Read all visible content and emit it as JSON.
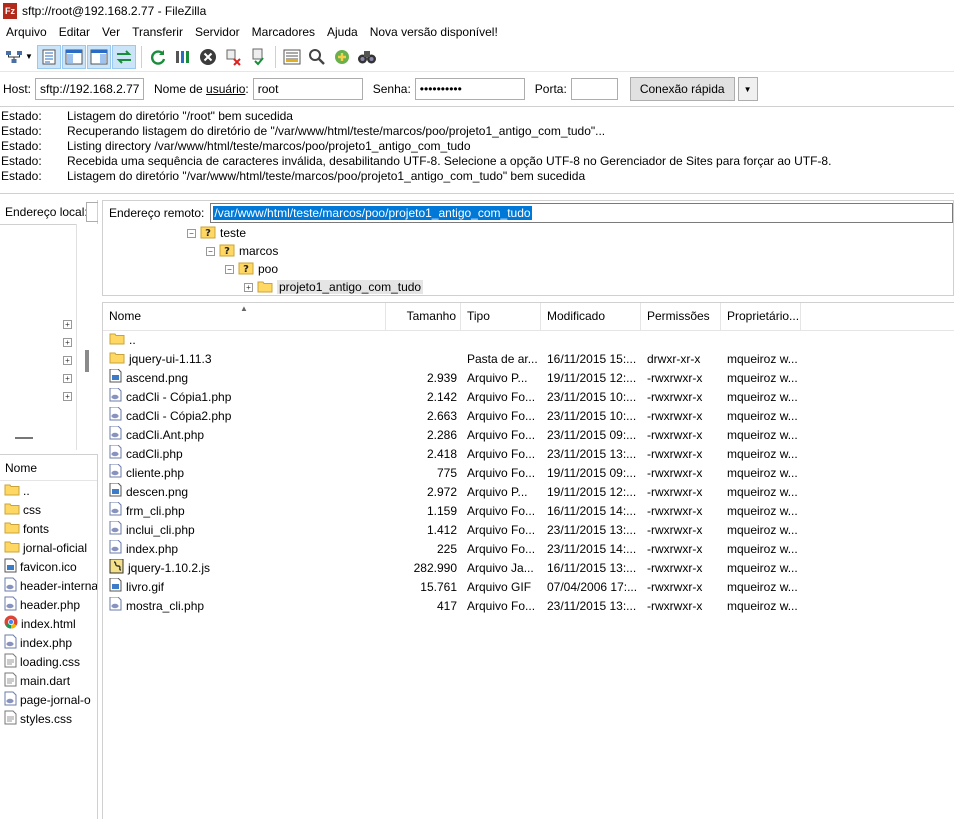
{
  "window": {
    "app_icon_text": "Fz",
    "title": "sftp://root@192.168.2.77 - FileZilla"
  },
  "menu": {
    "items": [
      "Arquivo",
      "Editar",
      "Ver",
      "Transferir",
      "Servidor",
      "Marcadores",
      "Ajuda",
      "Nova versão disponível!"
    ]
  },
  "toolbar": {
    "icons": [
      "site-manager-icon",
      "dropdown-caret-icon",
      "toggle-log-icon",
      "toggle-local-tree-icon",
      "toggle-remote-tree-icon",
      "toggle-queue-icon",
      "refresh-icon",
      "process-queue-icon",
      "cancel-icon",
      "disconnect-icon",
      "reconnect-icon",
      "filter-icon",
      "toggle-compare-icon",
      "sync-browse-icon",
      "search-binoculars-icon"
    ]
  },
  "quickconnect": {
    "host_label": "Host:",
    "host_value": "sftp://192.168.2.77",
    "user_label_pre": "Nome de ",
    "user_label_u": "usuário",
    "user_label_post": ":",
    "user_value": "root",
    "pass_label": "Senha:",
    "pass_value": "••••••••••",
    "port_label": "Porta:",
    "port_value": "",
    "connect_button": "Conexão rápida"
  },
  "log": {
    "entries": [
      {
        "label": "Estado:",
        "msg": "Listagem do diretório \"/root\" bem sucedida"
      },
      {
        "label": "Estado:",
        "msg": "Recuperando listagem do diretório de \"/var/www/html/teste/marcos/poo/projeto1_antigo_com_tudo\"..."
      },
      {
        "label": "Estado:",
        "msg": "Listing directory /var/www/html/teste/marcos/poo/projeto1_antigo_com_tudo"
      },
      {
        "label": "Estado:",
        "msg": "Recebida uma sequência de caracteres inválida, desabilitando UTF-8. Selecione a opção UTF-8 no Gerenciador de Sites para forçar ao UTF-8."
      },
      {
        "label": "Estado:",
        "msg": "Listagem do diretório \"/var/www/html/teste/marcos/poo/projeto1_antigo_com_tudo\" bem sucedida"
      }
    ]
  },
  "local": {
    "address_label": "Endereço local:",
    "list_header": "Nome",
    "files": [
      {
        "name": "..",
        "icon": "folder-icon"
      },
      {
        "name": "css",
        "icon": "folder-icon"
      },
      {
        "name": "fonts",
        "icon": "folder-icon"
      },
      {
        "name": "jornal-oficial",
        "icon": "folder-icon"
      },
      {
        "name": "favicon.ico",
        "icon": "image-file-icon"
      },
      {
        "name": "header-interna",
        "icon": "php-file-icon"
      },
      {
        "name": "header.php",
        "icon": "php-file-icon"
      },
      {
        "name": "index.html",
        "icon": "chrome-html-icon"
      },
      {
        "name": "index.php",
        "icon": "php-file-icon"
      },
      {
        "name": "loading.css",
        "icon": "text-file-icon"
      },
      {
        "name": "main.dart",
        "icon": "text-file-icon"
      },
      {
        "name": "page-jornal-o",
        "icon": "php-file-icon"
      },
      {
        "name": "styles.css",
        "icon": "text-file-icon"
      }
    ]
  },
  "remote": {
    "address_label": "Endereço remoto:",
    "address_value": "/var/www/html/teste/marcos/poo/projeto1_antigo_com_tudo",
    "tree": [
      {
        "label": "teste",
        "icon": "unknown-folder-icon",
        "exp": "−"
      },
      {
        "label": "marcos",
        "icon": "unknown-folder-icon",
        "exp": "−"
      },
      {
        "label": "poo",
        "icon": "unknown-folder-icon",
        "exp": "−"
      },
      {
        "label": "projeto1_antigo_com_tudo",
        "icon": "folder-icon",
        "exp": "+"
      }
    ],
    "columns": {
      "name": "Nome",
      "size": "Tamanho",
      "type": "Tipo",
      "modified": "Modificado",
      "permissions": "Permissões",
      "owner": "Proprietário..."
    },
    "files": [
      {
        "name": "..",
        "size": "",
        "type": "",
        "modified": "",
        "permissions": "",
        "owner": "",
        "icon": "folder-icon"
      },
      {
        "name": "jquery-ui-1.11.3",
        "size": "",
        "type": "Pasta de ar...",
        "modified": "16/11/2015 15:...",
        "permissions": "drwxr-xr-x",
        "owner": "mqueiroz w...",
        "icon": "folder-icon"
      },
      {
        "name": "ascend.png",
        "size": "2.939",
        "type": "Arquivo P...",
        "modified": "19/11/2015 12:...",
        "permissions": "-rwxrwxr-x",
        "owner": "mqueiroz w...",
        "icon": "image-file-icon"
      },
      {
        "name": "cadCli - Cópia1.php",
        "size": "2.142",
        "type": "Arquivo Fo...",
        "modified": "23/11/2015 10:...",
        "permissions": "-rwxrwxr-x",
        "owner": "mqueiroz w...",
        "icon": "php-file-icon"
      },
      {
        "name": "cadCli - Cópia2.php",
        "size": "2.663",
        "type": "Arquivo Fo...",
        "modified": "23/11/2015 10:...",
        "permissions": "-rwxrwxr-x",
        "owner": "mqueiroz w...",
        "icon": "php-file-icon"
      },
      {
        "name": "cadCli.Ant.php",
        "size": "2.286",
        "type": "Arquivo Fo...",
        "modified": "23/11/2015 09:...",
        "permissions": "-rwxrwxr-x",
        "owner": "mqueiroz w...",
        "icon": "php-file-icon"
      },
      {
        "name": "cadCli.php",
        "size": "2.418",
        "type": "Arquivo Fo...",
        "modified": "23/11/2015 13:...",
        "permissions": "-rwxrwxr-x",
        "owner": "mqueiroz w...",
        "icon": "php-file-icon"
      },
      {
        "name": "cliente.php",
        "size": "775",
        "type": "Arquivo Fo...",
        "modified": "19/11/2015 09:...",
        "permissions": "-rwxrwxr-x",
        "owner": "mqueiroz w...",
        "icon": "php-file-icon"
      },
      {
        "name": "descen.png",
        "size": "2.972",
        "type": "Arquivo P...",
        "modified": "19/11/2015 12:...",
        "permissions": "-rwxrwxr-x",
        "owner": "mqueiroz w...",
        "icon": "image-file-icon"
      },
      {
        "name": "frm_cli.php",
        "size": "1.159",
        "type": "Arquivo Fo...",
        "modified": "16/11/2015 14:...",
        "permissions": "-rwxrwxr-x",
        "owner": "mqueiroz w...",
        "icon": "php-file-icon"
      },
      {
        "name": "inclui_cli.php",
        "size": "1.412",
        "type": "Arquivo Fo...",
        "modified": "23/11/2015 13:...",
        "permissions": "-rwxrwxr-x",
        "owner": "mqueiroz w...",
        "icon": "php-file-icon"
      },
      {
        "name": "index.php",
        "size": "225",
        "type": "Arquivo Fo...",
        "modified": "23/11/2015 14:...",
        "permissions": "-rwxrwxr-x",
        "owner": "mqueiroz w...",
        "icon": "php-file-icon"
      },
      {
        "name": "jquery-1.10.2.js",
        "size": "282.990",
        "type": "Arquivo Ja...",
        "modified": "16/11/2015 13:...",
        "permissions": "-rwxrwxr-x",
        "owner": "mqueiroz w...",
        "icon": "js-file-icon"
      },
      {
        "name": "livro.gif",
        "size": "15.761",
        "type": "Arquivo GIF",
        "modified": "07/04/2006 17:...",
        "permissions": "-rwxrwxr-x",
        "owner": "mqueiroz w...",
        "icon": "image-file-icon"
      },
      {
        "name": "mostra_cli.php",
        "size": "417",
        "type": "Arquivo Fo...",
        "modified": "23/11/2015 13:...",
        "permissions": "-rwxrwxr-x",
        "owner": "mqueiroz w...",
        "icon": "php-file-icon"
      }
    ]
  },
  "colors": {
    "selection": "#0078d7",
    "folder": "#ffd864",
    "toolbar_active": "#cce4f7"
  }
}
